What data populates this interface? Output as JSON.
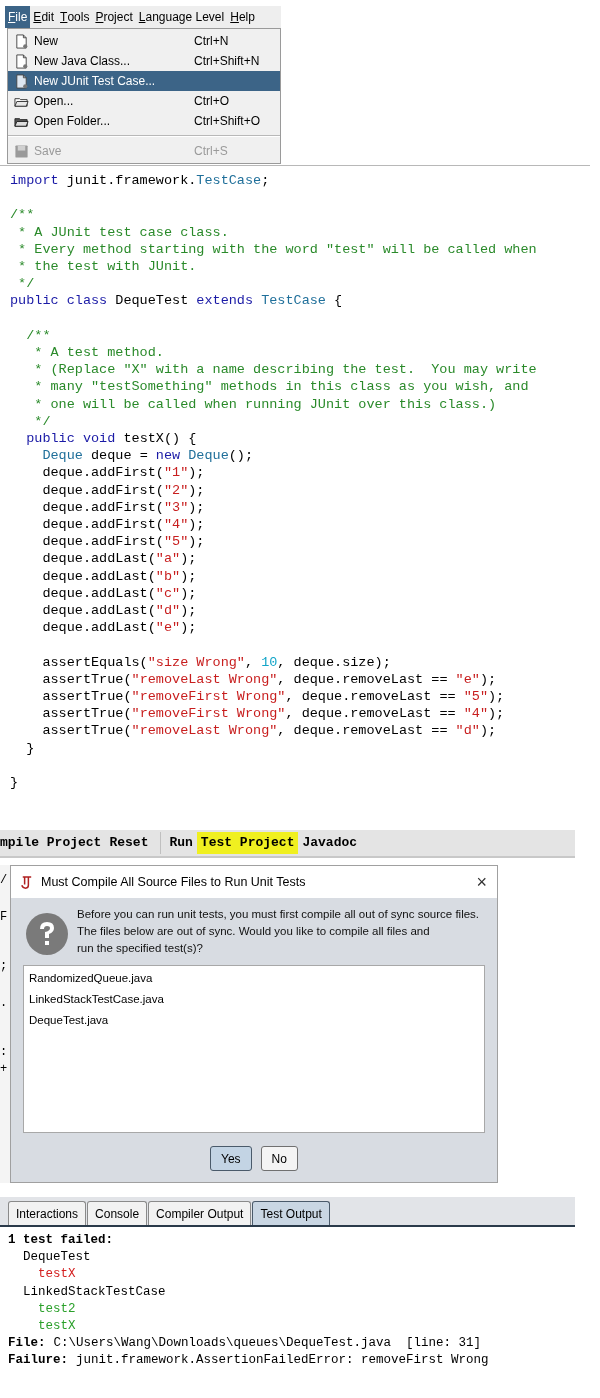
{
  "menu_bar": {
    "items": [
      {
        "label": "File",
        "selected": true
      },
      {
        "label": "Edit",
        "selected": false
      },
      {
        "label": "Tools",
        "selected": false
      },
      {
        "label": "Project",
        "selected": false
      },
      {
        "label": "Language Level",
        "selected": false
      },
      {
        "label": "Help",
        "selected": false
      }
    ]
  },
  "file_menu": {
    "items": [
      {
        "kind": "new",
        "label": "New",
        "shortcut": "Ctrl+N",
        "selected": false,
        "disabled": false
      },
      {
        "kind": "new",
        "label": "New Java Class...",
        "shortcut": "Ctrl+Shift+N",
        "selected": false,
        "disabled": false
      },
      {
        "kind": "new",
        "label": "New JUnit Test Case...",
        "selected": true,
        "disabled": false
      },
      {
        "kind": "open",
        "label": "Open...",
        "shortcut": "Ctrl+O",
        "selected": false,
        "disabled": false
      },
      {
        "kind": "folder",
        "label": "Open Folder...",
        "shortcut": "Ctrl+Shift+O",
        "selected": false,
        "disabled": false
      },
      {
        "kind": "separator"
      },
      {
        "kind": "save",
        "label": "Save",
        "shortcut": "Ctrl+S",
        "selected": false,
        "disabled": true
      }
    ]
  },
  "code_editor": {
    "lines": [
      [
        {
          "kind": "keyword",
          "text": "import"
        },
        {
          "kind": "plain",
          "text": " junit.framework."
        },
        {
          "kind": "type",
          "text": "TestCase"
        },
        {
          "kind": "plain",
          "text": ";"
        }
      ],
      {
        "blank_line_before": true,
        "tokens": [
          {
            "kind": "comment",
            "text": "/**"
          }
        ]
      },
      [
        {
          "kind": "comment",
          "text": " * A JUnit test case class."
        }
      ],
      [
        {
          "kind": "comment",
          "text": " * Every method starting with the word \"test\" will be called when"
        }
      ],
      [
        {
          "kind": "comment",
          "text": " * the test with JUnit."
        }
      ],
      [
        {
          "kind": "comment",
          "text": " */"
        }
      ],
      [
        {
          "kind": "keyword",
          "text": "public class"
        },
        {
          "kind": "plain",
          "text": " DequeTest "
        },
        {
          "kind": "keyword",
          "text": "extends "
        },
        {
          "kind": "type",
          "text": "TestCase"
        },
        {
          "kind": "plain",
          "text": " {"
        }
      ],
      {
        "blank_line_before": true,
        "tokens": [
          {
            "kind": "comment",
            "text": "  /**"
          }
        ]
      },
      [
        {
          "kind": "comment",
          "text": "   * A test method."
        }
      ],
      [
        {
          "kind": "comment",
          "text": "   * (Replace \"X\" with a name describing the test.  You may write"
        }
      ],
      [
        {
          "kind": "comment",
          "text": "   * many \"testSomething\" methods in this class as you wish, and"
        }
      ],
      [
        {
          "kind": "comment",
          "text": "   * one will be called when running JUnit over this class.)"
        }
      ],
      [
        {
          "kind": "comment",
          "text": "   */"
        }
      ],
      [
        {
          "kind": "keyword",
          "text": "  public void"
        },
        {
          "kind": "plain",
          "text": " testX() {"
        }
      ],
      [
        {
          "kind": "type",
          "text": "    Deque"
        },
        {
          "kind": "plain",
          "text": " deque = "
        },
        {
          "kind": "keyword",
          "text": "new"
        },
        {
          "kind": "type",
          "text": " Deque"
        },
        {
          "kind": "plain",
          "text": "();"
        }
      ],
      [
        {
          "kind": "plain",
          "text": "    deque.addFirst("
        },
        {
          "kind": "string",
          "text": "\"1\""
        },
        {
          "kind": "plain",
          "text": ");"
        }
      ],
      [
        {
          "kind": "plain",
          "text": "    deque.addFirst("
        },
        {
          "kind": "string",
          "text": "\"2\""
        },
        {
          "kind": "plain",
          "text": ");"
        }
      ],
      [
        {
          "kind": "plain",
          "text": "    deque.addFirst("
        },
        {
          "kind": "string",
          "text": "\"3\""
        },
        {
          "kind": "plain",
          "text": ");"
        }
      ],
      [
        {
          "kind": "plain",
          "text": "    deque.addFirst("
        },
        {
          "kind": "string",
          "text": "\"4\""
        },
        {
          "kind": "plain",
          "text": ");"
        }
      ],
      [
        {
          "kind": "plain",
          "text": "    deque.addFirst("
        },
        {
          "kind": "string",
          "text": "\"5\""
        },
        {
          "kind": "plain",
          "text": ");"
        }
      ],
      [
        {
          "kind": "plain",
          "text": "    deque.addLast("
        },
        {
          "kind": "string",
          "text": "\"a\""
        },
        {
          "kind": "plain",
          "text": ");"
        }
      ],
      [
        {
          "kind": "plain",
          "text": "    deque.addLast("
        },
        {
          "kind": "string",
          "text": "\"b\""
        },
        {
          "kind": "plain",
          "text": ");"
        }
      ],
      [
        {
          "kind": "plain",
          "text": "    deque.addLast("
        },
        {
          "kind": "string",
          "text": "\"c\""
        },
        {
          "kind": "plain",
          "text": ");"
        }
      ],
      [
        {
          "kind": "plain",
          "text": "    deque.addLast("
        },
        {
          "kind": "string",
          "text": "\"d\""
        },
        {
          "kind": "plain",
          "text": ");"
        }
      ],
      [
        {
          "kind": "plain",
          "text": "    deque.addLast("
        },
        {
          "kind": "string",
          "text": "\"e\""
        },
        {
          "kind": "plain",
          "text": ");"
        }
      ],
      {
        "blank_line_before": true,
        "tokens": [
          {
            "kind": "plain",
            "text": "    assertEquals("
          },
          {
            "kind": "string",
            "text": "\"size Wrong\""
          },
          {
            "kind": "plain",
            "text": ", "
          },
          {
            "kind": "number",
            "text": "10"
          },
          {
            "kind": "plain",
            "text": ", deque.size);"
          }
        ]
      },
      [
        {
          "kind": "plain",
          "text": "    assertTrue("
        },
        {
          "kind": "string",
          "text": "\"removeLast Wrong\""
        },
        {
          "kind": "plain",
          "text": ", deque.removeLast == "
        },
        {
          "kind": "string",
          "text": "\"e\""
        },
        {
          "kind": "plain",
          "text": ");"
        }
      ],
      [
        {
          "kind": "plain",
          "text": "    assertTrue("
        },
        {
          "kind": "string",
          "text": "\"removeFirst Wrong\""
        },
        {
          "kind": "plain",
          "text": ", deque.removeLast == "
        },
        {
          "kind": "string",
          "text": "\"5\""
        },
        {
          "kind": "plain",
          "text": ");"
        }
      ],
      [
        {
          "kind": "plain",
          "text": "    assertTrue("
        },
        {
          "kind": "string",
          "text": "\"removeFirst Wrong\""
        },
        {
          "kind": "plain",
          "text": ", deque.removeLast == "
        },
        {
          "kind": "string",
          "text": "\"4\""
        },
        {
          "kind": "plain",
          "text": ");"
        }
      ],
      [
        {
          "kind": "plain",
          "text": "    assertTrue("
        },
        {
          "kind": "string",
          "text": "\"removeLast Wrong\""
        },
        {
          "kind": "plain",
          "text": ", deque.removeLast == "
        },
        {
          "kind": "string",
          "text": "\"d\""
        },
        {
          "kind": "plain",
          "text": ");"
        }
      ],
      [
        {
          "kind": "plain",
          "text": "  }"
        }
      ],
      {
        "blank_line_before": true,
        "tokens": [
          {
            "kind": "plain",
            "text": "}"
          }
        ]
      }
    ]
  },
  "toolbar": {
    "groups": [
      [
        {
          "label": "mpile Project",
          "highlighted": false
        },
        {
          "label": "Reset",
          "highlighted": false
        }
      ],
      [
        {
          "label": "Run",
          "highlighted": false
        },
        {
          "label": "Test Project",
          "highlighted": true
        },
        {
          "label": "Javadoc",
          "highlighted": false
        }
      ]
    ]
  },
  "editor_fragments": [
    "/",
    "F",
    ";",
    ".",
    ":",
    "+"
  ],
  "dialog": {
    "title": "Must Compile All Source Files to Run Unit Tests",
    "close": "×",
    "message": [
      "Before you can run unit tests, you must first compile all out of sync source files.",
      "The files below are out of sync. Would you like to compile all files and",
      "run the specified test(s)?"
    ],
    "files": [
      "RandomizedQueue.java",
      "LinkedStackTestCase.java",
      "DequeTest.java"
    ],
    "buttons": [
      {
        "label": "Yes",
        "selected": true
      },
      {
        "label": "No",
        "selected": false
      }
    ]
  },
  "output_tabs": [
    {
      "label": "Interactions",
      "selected": false
    },
    {
      "label": "Console",
      "selected": false
    },
    {
      "label": "Compiler Output",
      "selected": false
    },
    {
      "label": "Test Output",
      "selected": true
    }
  ],
  "test_output": {
    "summary": "1 test failed:",
    "classes": [
      {
        "name": "DequeTest",
        "children": [
          {
            "name": "testX",
            "passed": false
          }
        ]
      },
      {
        "name": "LinkedStackTestCase",
        "children": [
          {
            "name": "test2",
            "passed": true
          },
          {
            "name": "testX",
            "passed": true
          }
        ]
      }
    ],
    "details": [
      {
        "label": "File:",
        "value": "C:\\Users\\Wang\\Downloads\\queues\\DequeTest.java  [line: 31]"
      },
      {
        "label": "Failure:",
        "value": "junit.framework.AssertionFailedError: removeFirst Wrong"
      }
    ]
  }
}
